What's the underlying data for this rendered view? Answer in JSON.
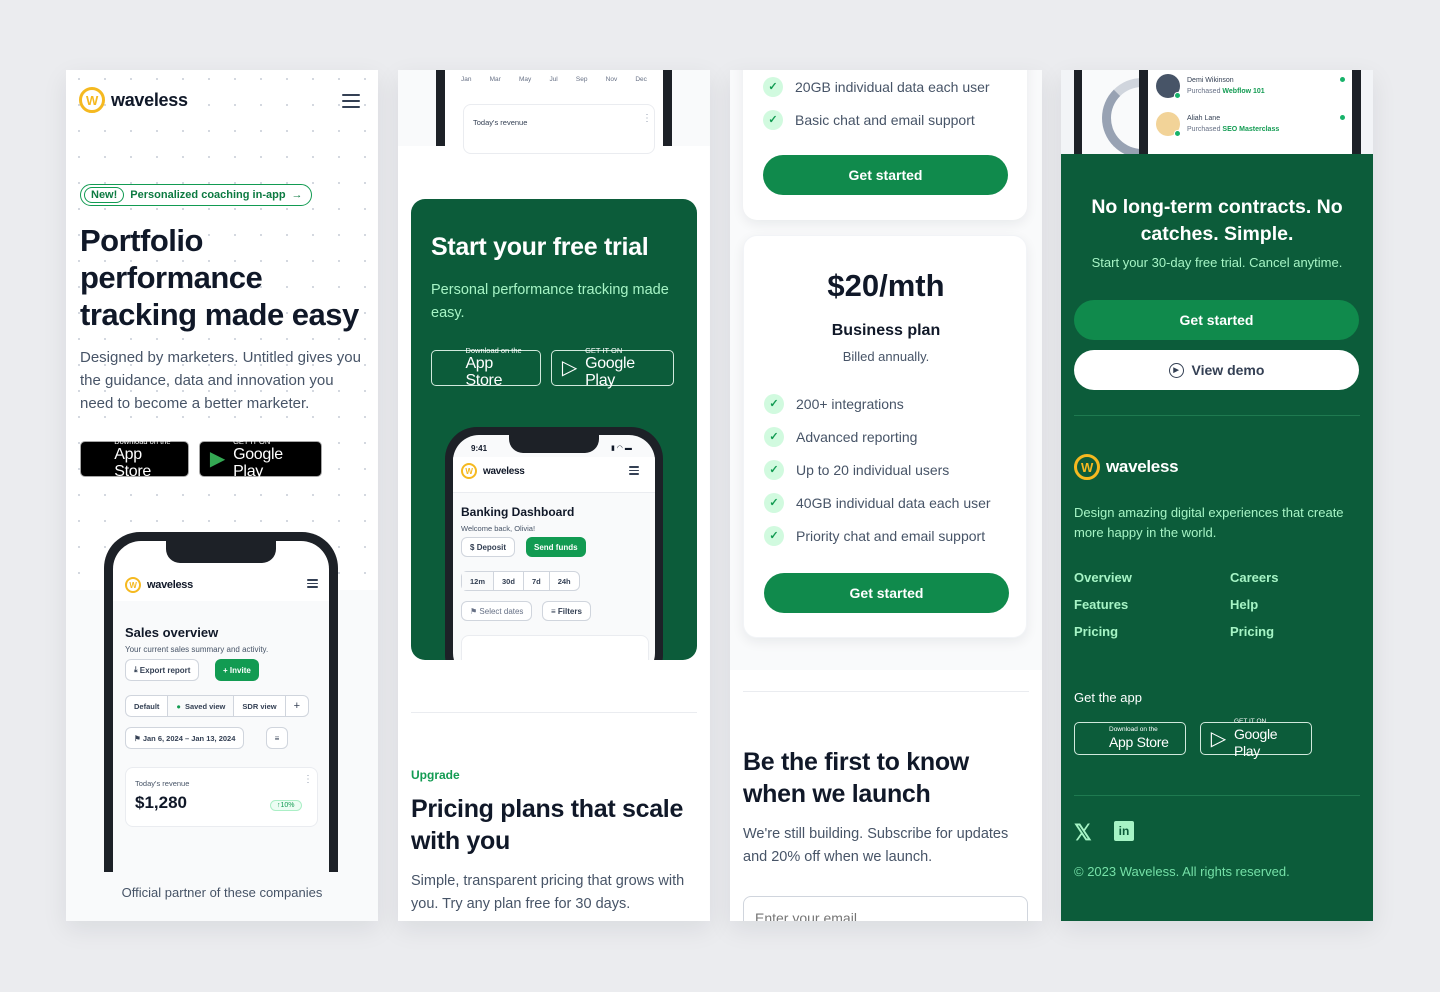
{
  "brand": {
    "name": "waveless",
    "logo_letter": "W",
    "accent": "#129b52",
    "dark_green": "#0c5c3a",
    "logo_yellow": "#f5b920"
  },
  "panel1": {
    "badge_new": "New!",
    "badge_text": "Personalized coaching in-app",
    "headline": "Portfolio performance tracking made easy",
    "subtext": "Designed by marketers. Untitled gives you the guidance, data and innovation you need to become a better marketer.",
    "app_store": {
      "small": "Download on the",
      "big": "App Store"
    },
    "google_play": {
      "small": "GET IT ON",
      "big": "Google Play"
    },
    "phone": {
      "title": "Sales overview",
      "subtitle": "Your current sales summary and activity.",
      "export_label": "Export report",
      "invite_label": "Invite",
      "views": [
        "Default",
        "Saved view",
        "SDR view",
        "+"
      ],
      "date_range": "Jan 6, 2024 – Jan 13, 2024",
      "revenue_label": "Today's revenue",
      "revenue_value": "$1,280",
      "revenue_change": "10%"
    },
    "partner_text": "Official partner of these companies"
  },
  "panel2": {
    "phone_top": {
      "months": [
        "Jan",
        "Mar",
        "May",
        "Jul",
        "Sep",
        "Nov",
        "Dec"
      ],
      "revenue_label": "Today's revenue"
    },
    "trial_title": "Start your free trial",
    "trial_sub": "Personal performance tracking made easy.",
    "app_store": {
      "small": "Download on the",
      "big": "App Store"
    },
    "google_play": {
      "small": "GET IT ON",
      "big": "Google Play"
    },
    "phone": {
      "time": "9:41",
      "title": "Banking Dashboard",
      "subtitle": "Welcome back, Olivia!",
      "deposit_label": "Deposit",
      "send_label": "Send funds",
      "ranges": [
        "12m",
        "30d",
        "7d",
        "24h"
      ],
      "select_dates": "Select dates",
      "filters": "Filters"
    },
    "eyebrow": "Upgrade",
    "pricing_title": "Pricing plans that scale with you",
    "pricing_sub": "Simple, transparent pricing that grows with you. Try any plan free for 30 days."
  },
  "panel3": {
    "plan1_features": [
      "20GB individual data each user",
      "Basic chat and email support"
    ],
    "plan1_cta": "Get started",
    "plan2": {
      "price": "$20/mth",
      "name": "Business plan",
      "billing": "Billed annually.",
      "features": [
        "200+ integrations",
        "Advanced reporting",
        "Up to 20 individual users",
        "40GB individual data each user",
        "Priority chat and email support"
      ],
      "cta": "Get started"
    },
    "launch_title": "Be the first to know when we launch",
    "launch_sub": "We're still building. Subscribe for updates and 20% off when we launch.",
    "email_placeholder": "Enter your email"
  },
  "panel4": {
    "activity": [
      {
        "name": "Demi Wikinson",
        "action": "Purchased",
        "item": "Webflow 101"
      },
      {
        "name": "Aliah Lane",
        "action": "Purchased",
        "item": "SEO Masterclass"
      }
    ],
    "cta_title": "No long-term contracts. No catches. Simple.",
    "cta_sub": "Start your 30-day free trial. Cancel anytime.",
    "get_started": "Get started",
    "view_demo": "View demo",
    "footer_desc": "Design amazing digital experiences that create more happy in the world.",
    "links_col1": [
      "Overview",
      "Features",
      "Pricing"
    ],
    "links_col2": [
      "Careers",
      "Help",
      "Pricing"
    ],
    "get_app": "Get the app",
    "app_store": {
      "small": "Download on the",
      "big": "App Store"
    },
    "google_play": {
      "small": "GET IT ON",
      "big": "Google Play"
    },
    "copyright": "© 2023 Waveless. All rights reserved."
  }
}
